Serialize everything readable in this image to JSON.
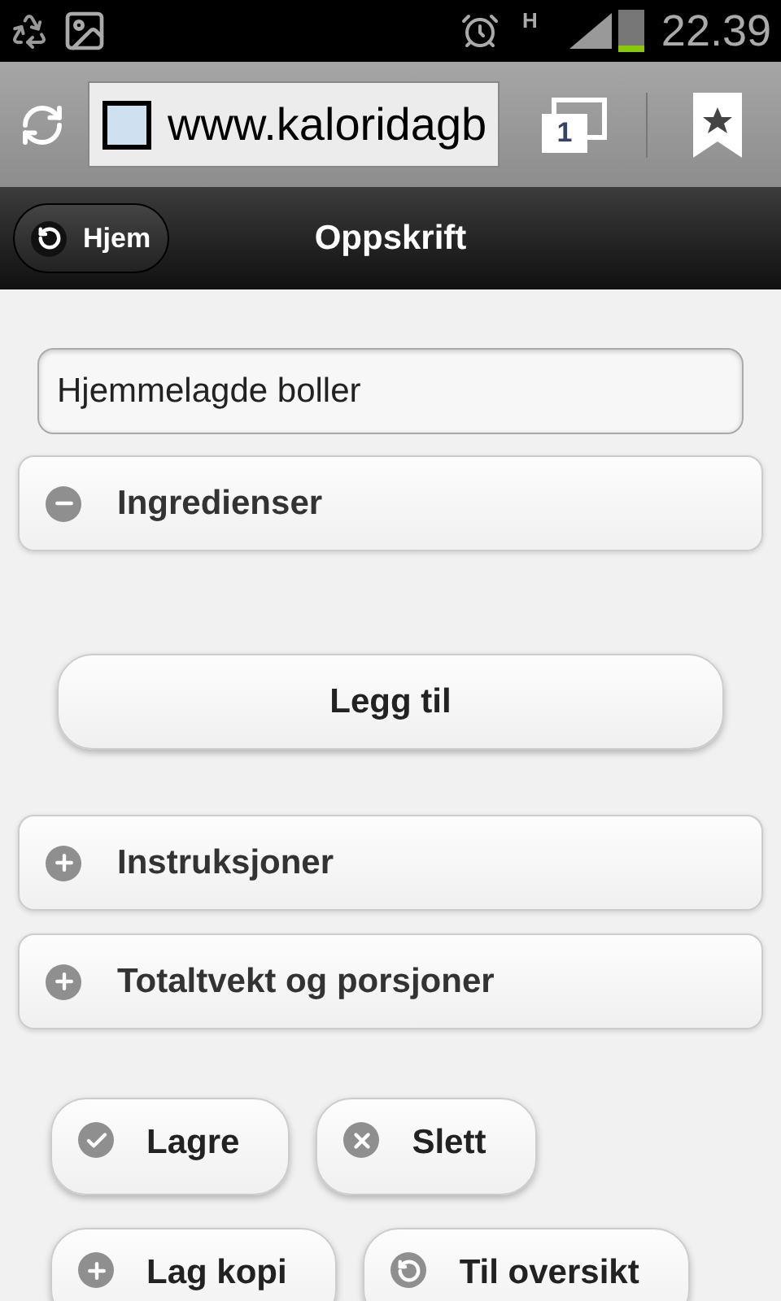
{
  "status_bar": {
    "network": "H",
    "time": "22.39"
  },
  "browser": {
    "url": "www.kaloridagb",
    "tab_count": "1"
  },
  "header": {
    "back_button": "Hjem",
    "title": "Oppskrift"
  },
  "name_field": {
    "value": "Hjemmelagde boller"
  },
  "sections": [
    {
      "label": "Ingredienser",
      "expanded": true,
      "button": "Legg til"
    },
    {
      "label": "Instruksjoner",
      "expanded": false
    },
    {
      "label": "Totaltvekt og porsjoner",
      "expanded": false
    }
  ],
  "actions": [
    [
      {
        "label": "Lagre",
        "kind": "check"
      },
      {
        "label": "Slett",
        "kind": "delete"
      }
    ],
    [
      {
        "label": "Lag kopi",
        "kind": "plus"
      },
      {
        "label": "Til oversikt",
        "kind": "back"
      }
    ]
  ]
}
